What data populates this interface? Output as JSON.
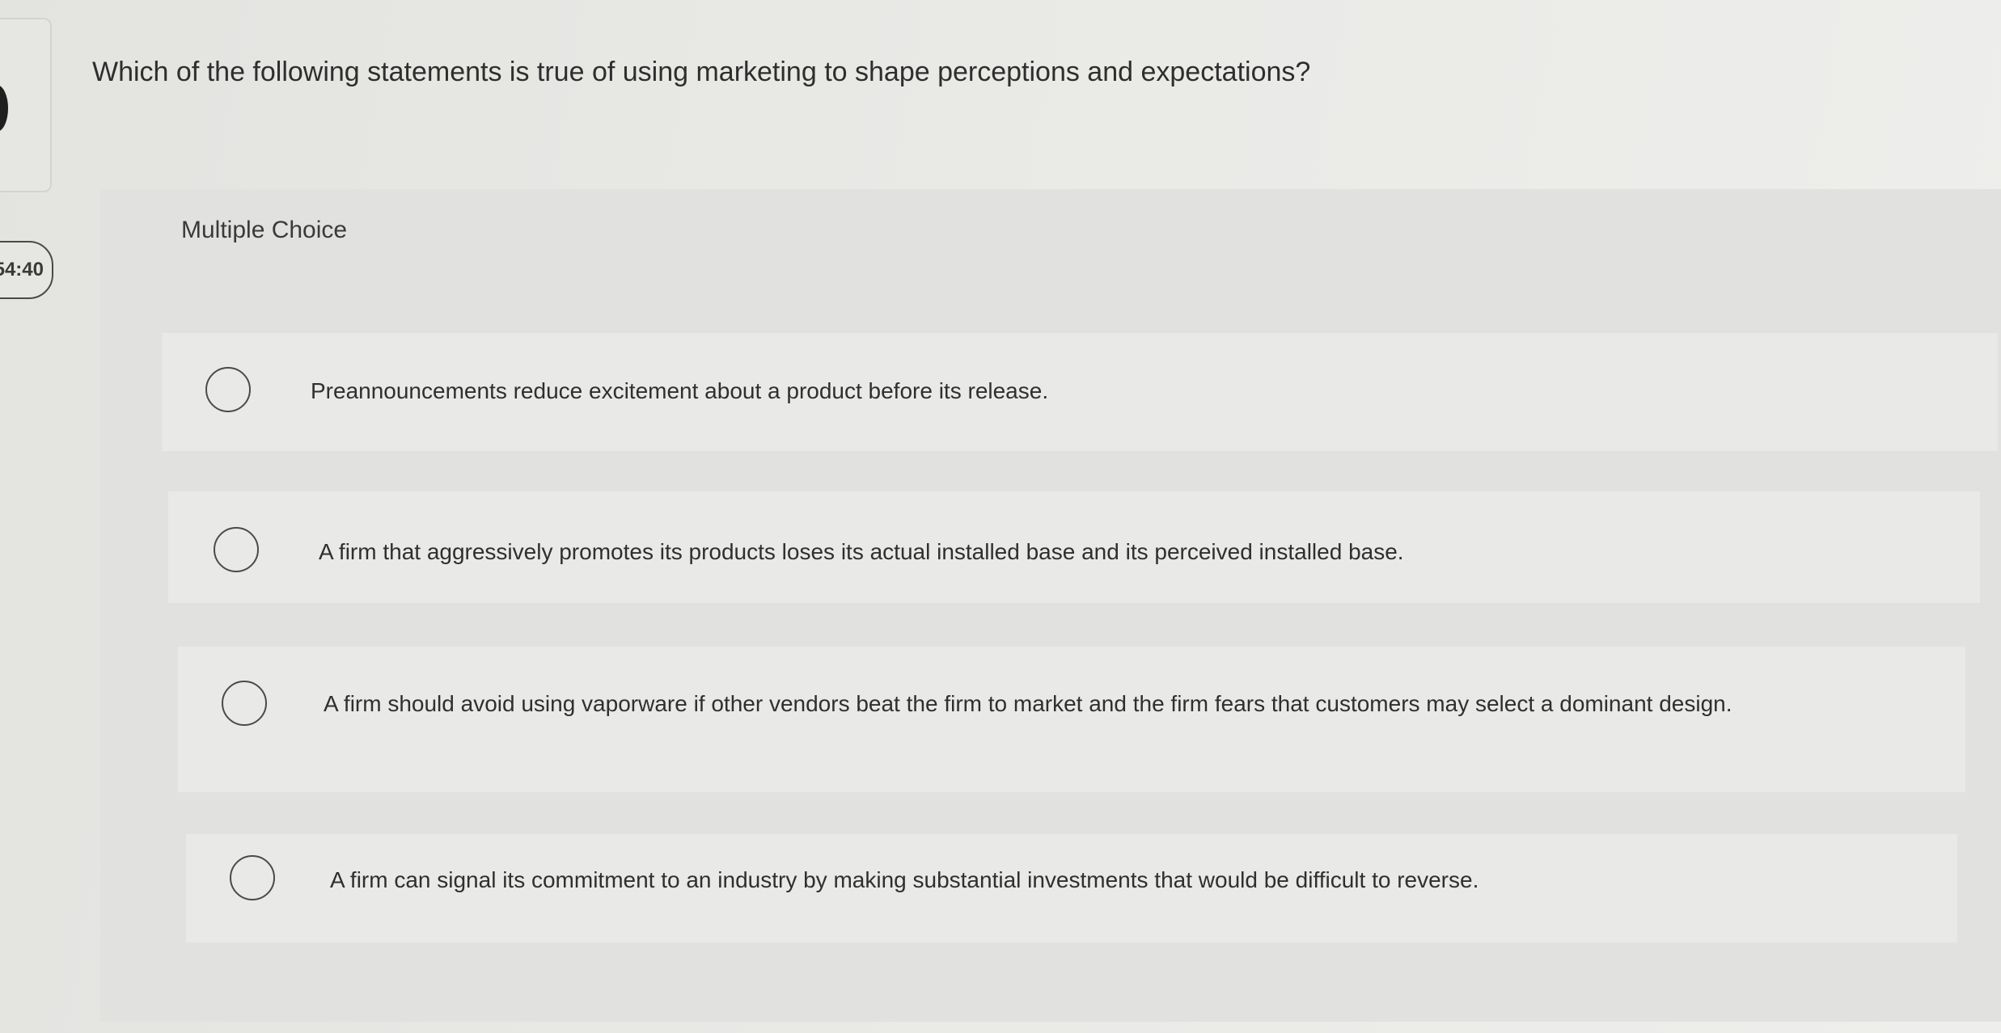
{
  "timer": "54:40",
  "question": "Which of the following statements is true of using marketing to shape perceptions and expectations?",
  "question_type": "Multiple Choice",
  "options": [
    {
      "text": "Preannouncements reduce excitement about a product before its release.",
      "selected": false
    },
    {
      "text": "A firm that aggressively promotes its products loses its actual installed base and its perceived installed base.",
      "selected": false
    },
    {
      "text": "A firm should avoid using vaporware if other vendors beat the firm to market and the firm fears that customers may select a dominant design.",
      "selected": false
    },
    {
      "text": "A firm can signal its commitment to an industry by making substantial investments that would be difficult to reverse.",
      "selected": false
    }
  ]
}
